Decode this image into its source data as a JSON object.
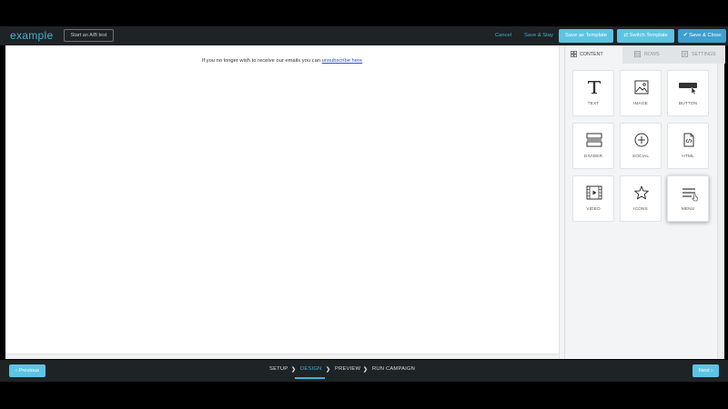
{
  "app": {
    "brand": "example",
    "ab_test_label": "Start an A/B test"
  },
  "toolbar": {
    "cancel": "Cancel",
    "save_stay": "Save & Stay",
    "save_template": "Save as Template",
    "switch_template": "⇄ Switch Template",
    "save_close": "✔ Save & Close"
  },
  "canvas": {
    "unsubscribe_text": "If you no longer wish to receive our emails you can",
    "unsubscribe_link": "unsubscribe here"
  },
  "panel": {
    "tabs": [
      {
        "label": "CONTENT",
        "icon": "grid-icon"
      },
      {
        "label": "ROWS",
        "icon": "rows-icon"
      },
      {
        "label": "SETTINGS",
        "icon": "settings-icon"
      }
    ],
    "tiles": [
      {
        "label": "TEXT",
        "icon": "text-icon"
      },
      {
        "label": "IMAGE",
        "icon": "image-icon"
      },
      {
        "label": "BUTTON",
        "icon": "button-icon"
      },
      {
        "label": "DIVIDER",
        "icon": "divider-icon"
      },
      {
        "label": "SOCIAL",
        "icon": "social-icon"
      },
      {
        "label": "HTML",
        "icon": "html-icon"
      },
      {
        "label": "VIDEO",
        "icon": "video-icon"
      },
      {
        "label": "ICONS",
        "icon": "star-icon"
      },
      {
        "label": "MENU",
        "icon": "menu-icon"
      }
    ]
  },
  "footer": {
    "previous": "‹ Previous",
    "next": "Next ›",
    "steps": [
      "SETUP",
      "DESIGN",
      "PREVIEW",
      "RUN CAMPAIGN"
    ],
    "active_step": "DESIGN"
  },
  "colors": {
    "accent": "#5cc4e2",
    "brand": "#3fb3d8",
    "bar": "#1e2326"
  }
}
